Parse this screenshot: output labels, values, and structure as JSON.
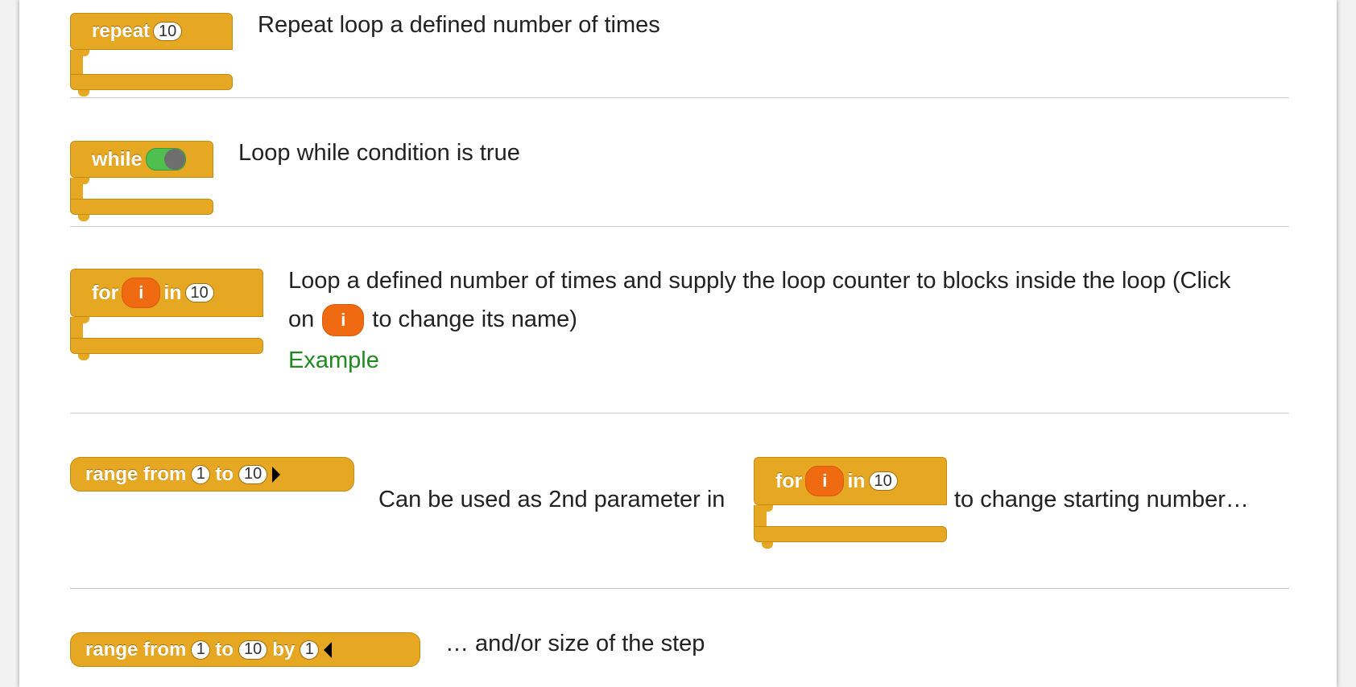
{
  "rows": [
    {
      "block": {
        "keyword": "repeat",
        "count": "10"
      },
      "description": "Repeat loop a defined number of times"
    },
    {
      "block": {
        "keyword": "while"
      },
      "description": "Loop while condition is true"
    },
    {
      "block": {
        "keyword": "for",
        "var": "i",
        "in": "in",
        "count": "10"
      },
      "description_line1": "Loop a defined number of times and supply the loop counter to blocks inside the loop (Click",
      "description_on": "on",
      "description_var": "i",
      "description_line2_rest": "to change its name)",
      "link": "Example"
    },
    {
      "block": {
        "keyword": "range from",
        "from": "1",
        "to_word": "to",
        "to": "10"
      },
      "description_before": "Can be used as 2nd parameter in",
      "inline_block": {
        "keyword": "for",
        "var": "i",
        "in": "in",
        "count": "10"
      },
      "description_after": "to change starting number…"
    },
    {
      "block": {
        "keyword": "range from",
        "from": "1",
        "to_word": "to",
        "to": "10",
        "by_word": "by",
        "by": "1"
      },
      "description": "… and/or size of the step"
    }
  ],
  "colors": {
    "block": "#e6a822",
    "variable": "#f06a12",
    "link": "#1f8a1f",
    "divider": "#c8c8c8"
  }
}
